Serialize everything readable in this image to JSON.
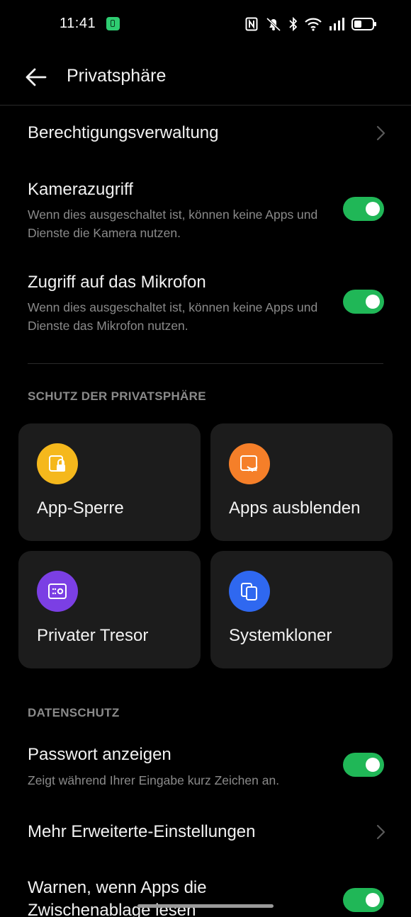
{
  "status_bar": {
    "time": "11:41",
    "icons": [
      "app-notification-icon",
      "nfc-icon",
      "mute-icon",
      "bluetooth-icon",
      "wifi-icon",
      "signal-icon",
      "battery-icon"
    ]
  },
  "header": {
    "back_icon": "arrow-left-icon",
    "title": "Privatsphäre"
  },
  "settings": {
    "permission_management": {
      "title": "Berechtigungsverwaltung"
    },
    "camera_access": {
      "title": "Kamerazugriff",
      "subtitle": "Wenn dies ausgeschaltet ist, können keine Apps und Dienste die Kamera nutzen.",
      "enabled": true
    },
    "microphone_access": {
      "title": "Zugriff auf das Mikrofon",
      "subtitle": "Wenn dies ausgeschaltet ist, können keine Apps und Dienste das Mikrofon nutzen.",
      "enabled": true
    }
  },
  "privacy_protection": {
    "section_title": "SCHUTZ DER PRIVATSPHÄRE",
    "cards": [
      {
        "label": "App-Sperre",
        "icon": "app-lock-icon",
        "color": "#f5b81c"
      },
      {
        "label": "Apps ausblenden",
        "icon": "hide-apps-icon",
        "color": "#f57f29"
      },
      {
        "label": "Privater Tresor",
        "icon": "private-safe-icon",
        "color": "#7b3fe4"
      },
      {
        "label": "Systemkloner",
        "icon": "system-cloner-icon",
        "color": "#2f68f0"
      }
    ]
  },
  "data_protection": {
    "section_title": "DATENSCHUTZ",
    "show_password": {
      "title": "Passwort anzeigen",
      "subtitle": "Zeigt während Ihrer Eingabe kurz Zeichen an.",
      "enabled": true
    },
    "more_advanced": {
      "title": "Mehr Erweiterte-Einstellungen"
    },
    "clipboard_warning": {
      "title_line1": "Warnen, wenn Apps die",
      "title_line2": "Zwischenablage lesen",
      "enabled": true
    }
  },
  "colors": {
    "background": "#000000",
    "card_background": "#1c1c1c",
    "toggle_on": "#20b757",
    "secondary_text": "#8a8a8a"
  }
}
